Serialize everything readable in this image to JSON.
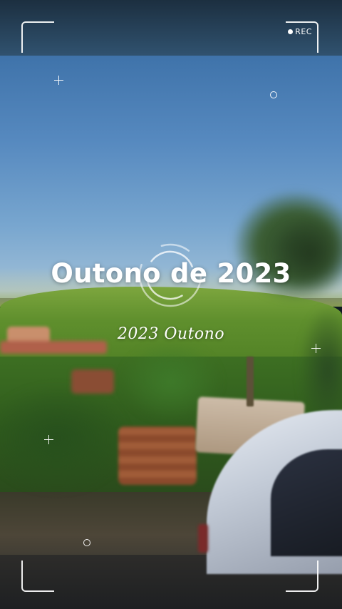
{
  "recorder": {
    "rec_label": "REC"
  },
  "overlay": {
    "title": "Outono de 2023",
    "subtitle": "2023 Outono"
  }
}
